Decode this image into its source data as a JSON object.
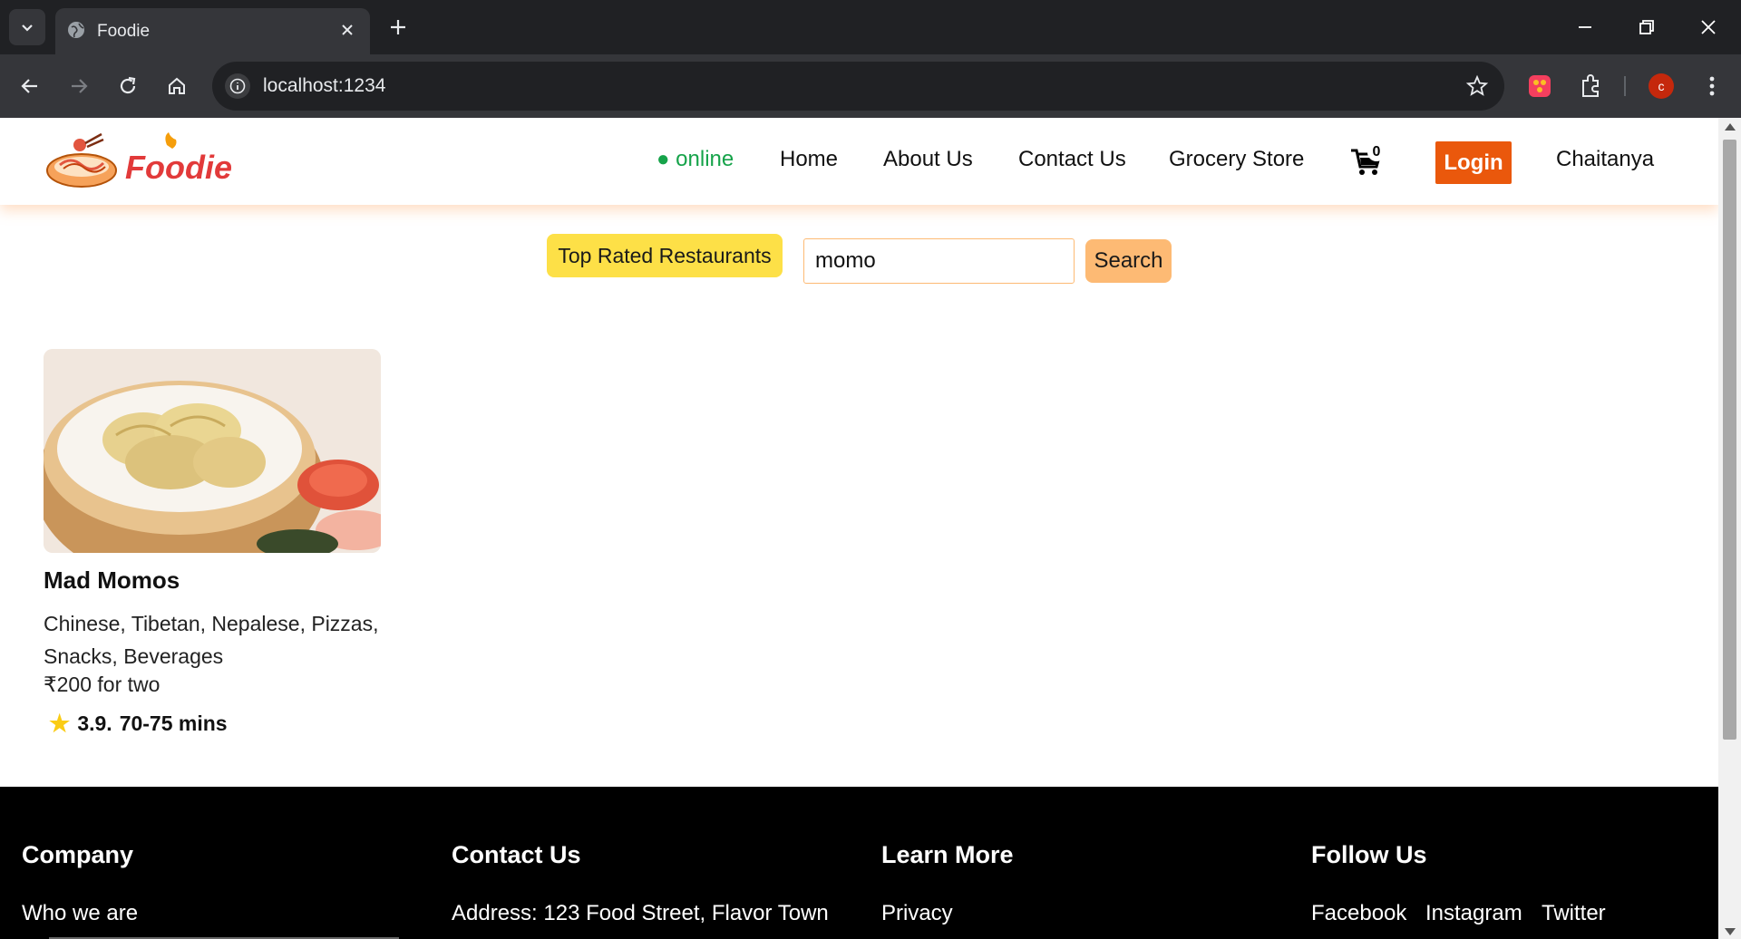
{
  "browser": {
    "tab_title": "Foodie",
    "url": "localhost:1234",
    "profile_initial": "c"
  },
  "header": {
    "logo_text": "Foodie",
    "status": "● online",
    "nav": [
      "Home",
      "About Us",
      "Contact Us",
      "Grocery Store"
    ],
    "cart_count": "0",
    "login_label": "Login",
    "user_name": "Chaitanya"
  },
  "filters": {
    "top_rated_label": "Top Rated Restaurants",
    "search_value": "momo",
    "search_label": "Search"
  },
  "restaurants": [
    {
      "name": "Mad Momos",
      "cuisines": "Chinese, Tibetan, Nepalese, Pizzas, Snacks, Beverages",
      "price": "₹200 for two",
      "rating": "3.9.",
      "delivery_time": "70-75 mins"
    }
  ],
  "footer": {
    "company": {
      "title": "Company",
      "item": "Who we are"
    },
    "contact": {
      "title": "Contact Us",
      "item": "Address: 123 Food Street, Flavor Town"
    },
    "learn": {
      "title": "Learn More",
      "item": "Privacy"
    },
    "follow": {
      "title": "Follow Us",
      "links": [
        "Facebook",
        "Instagram",
        "Twitter"
      ]
    }
  },
  "colors": {
    "accent": "#ea580c",
    "online": "#16a34a",
    "top_rated_bg": "#fde047",
    "search_bg": "#fdba74",
    "logo": "#e23a3a"
  }
}
